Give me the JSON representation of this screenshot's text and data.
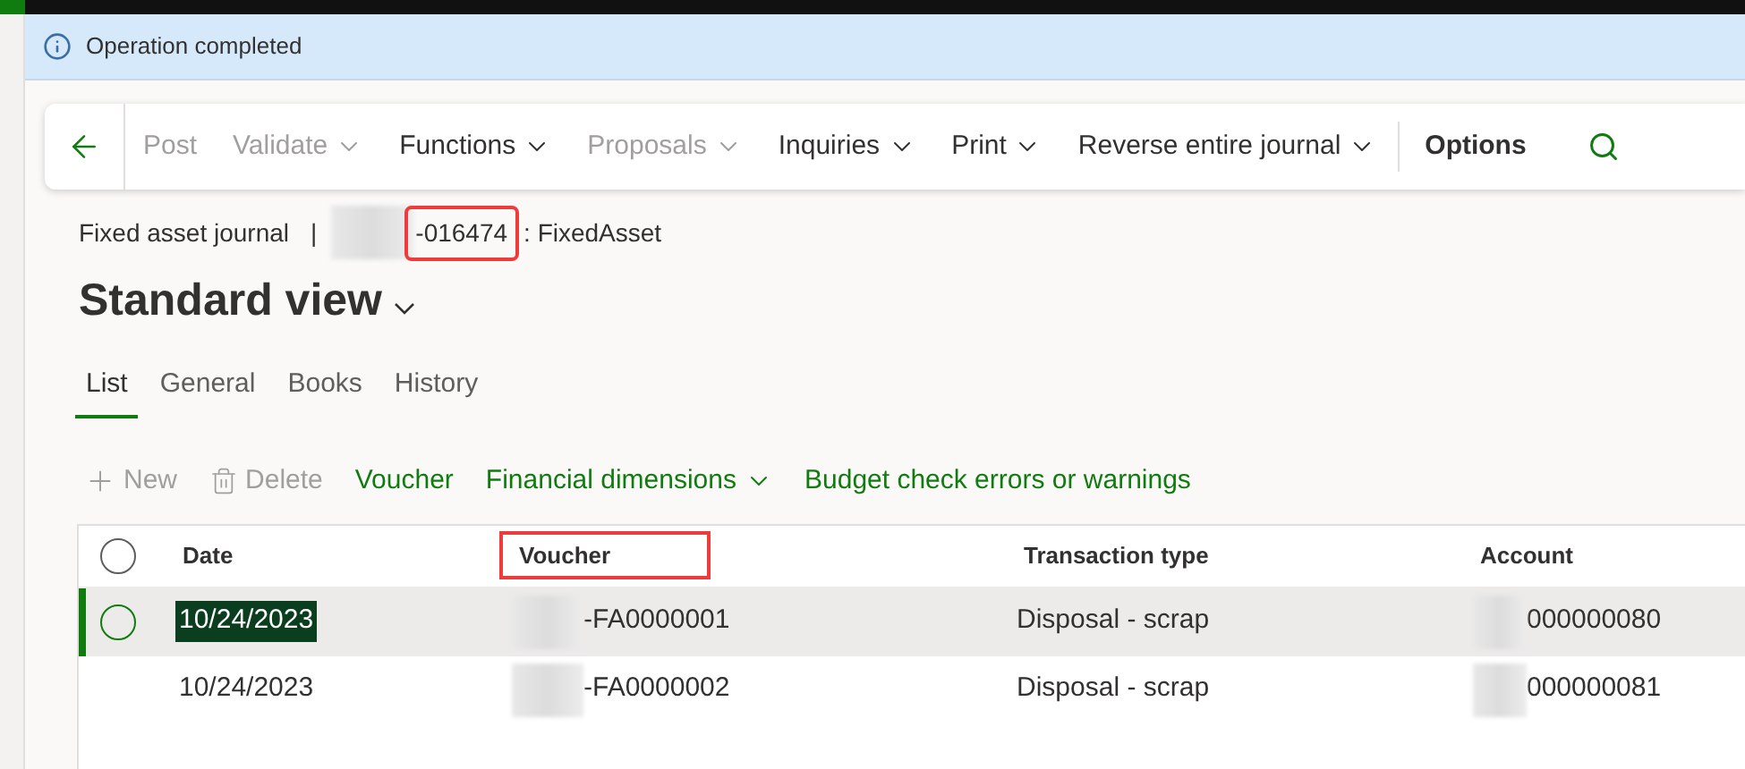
{
  "notification": {
    "message": "Operation completed"
  },
  "toolbar": {
    "items": [
      {
        "label": "Post",
        "disabled": true,
        "dropdown": false
      },
      {
        "label": "Validate",
        "disabled": true,
        "dropdown": true
      },
      {
        "label": "Functions",
        "disabled": false,
        "dropdown": true
      },
      {
        "label": "Proposals",
        "disabled": true,
        "dropdown": true
      },
      {
        "label": "Inquiries",
        "disabled": false,
        "dropdown": true
      },
      {
        "label": "Print",
        "disabled": false,
        "dropdown": true
      },
      {
        "label": "Reverse entire journal",
        "disabled": false,
        "dropdown": true
      }
    ],
    "options": "Options"
  },
  "header": {
    "title": "Fixed asset journal",
    "separator": "|",
    "number": "-016474",
    "number_highlighted": true,
    "suffix": ": FixedAsset"
  },
  "view": {
    "title": "Standard view"
  },
  "tabs": [
    {
      "label": "List",
      "selected": true
    },
    {
      "label": "General",
      "selected": false
    },
    {
      "label": "Books",
      "selected": false
    },
    {
      "label": "History",
      "selected": false
    }
  ],
  "actions": [
    {
      "kind": "new",
      "label": "New",
      "disabled": true
    },
    {
      "kind": "delete",
      "label": "Delete",
      "disabled": true
    },
    {
      "kind": "link",
      "label": "Voucher",
      "disabled": false
    },
    {
      "kind": "menu",
      "label": "Financial dimensions",
      "disabled": false
    },
    {
      "kind": "link",
      "label": "Budget check errors or warnings",
      "disabled": false
    }
  ],
  "table": {
    "all_selected": false,
    "columns": [
      {
        "label": "Date",
        "highlighted": false
      },
      {
        "label": "Voucher",
        "highlighted": true
      },
      {
        "label": "Transaction type",
        "highlighted": false
      },
      {
        "label": "Account",
        "highlighted": false
      }
    ],
    "rows": [
      {
        "selected": true,
        "cells": [
          "10/24/2023",
          "-FA0000001",
          "Disposal - scrap",
          "000000080"
        ]
      },
      {
        "selected": false,
        "cells": [
          "10/24/2023",
          "-FA0000002",
          "Disposal - scrap",
          "000000081"
        ]
      }
    ]
  }
}
